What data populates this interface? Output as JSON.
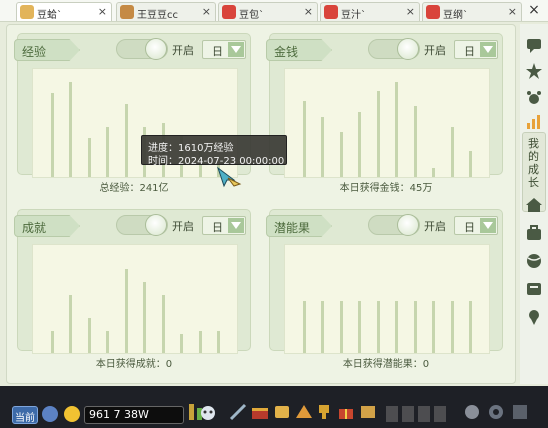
{
  "tabs": [
    {
      "label": "豆蛤`",
      "active": true
    },
    {
      "label": "王豆豆cc",
      "active": false
    },
    {
      "label": "豆包`",
      "active": false
    },
    {
      "label": "豆汁`",
      "active": false
    },
    {
      "label": "豆纲`",
      "active": false
    }
  ],
  "tab_close_glyph": "×",
  "window_close_glyph": "×",
  "cards": [
    {
      "title": "经验",
      "toggle_label": "开启",
      "period": "日",
      "caption": "总经验：241亿",
      "bars": [
        0.78,
        0.88,
        0.36,
        0.46,
        0.68,
        0.46,
        0.5,
        0.38,
        0.3,
        0.12
      ]
    },
    {
      "title": "金钱",
      "toggle_label": "开启",
      "period": "日",
      "caption": "本日获得金钱：45万",
      "bars": [
        0.7,
        0.56,
        0.42,
        0.6,
        0.8,
        0.88,
        0.66,
        0.08,
        0.46,
        0.24
      ]
    },
    {
      "title": "成就",
      "toggle_label": "开启",
      "period": "日",
      "caption": "本日获得成就：0",
      "bars": [
        0.2,
        0.54,
        0.32,
        0.2,
        0.78,
        0.66,
        0.54,
        0.18,
        0.2,
        0.2
      ]
    },
    {
      "title": "潜能果",
      "toggle_label": "开启",
      "period": "日",
      "caption": "本日获得潜能果：0",
      "bars": [
        0.48,
        0.48,
        0.48,
        0.48,
        0.48,
        0.48,
        0.48,
        0.48,
        0.48,
        0.48
      ]
    }
  ],
  "tooltip": {
    "progress": "进度：1610万经验",
    "time": "时间：2024-07-23 00:00:00"
  },
  "sidebar": {
    "active_tab": "我的成长"
  },
  "taskbar": {
    "current_label": "当前",
    "stats": "961 7  38W"
  }
}
